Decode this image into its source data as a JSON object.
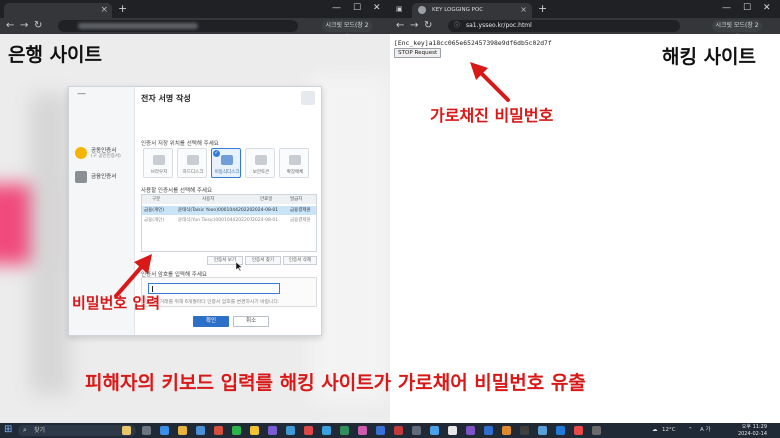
{
  "left_browser": {
    "tab_close": "×",
    "new_tab": "+",
    "window_controls": [
      "—",
      "☐",
      "✕"
    ],
    "nav": [
      "←",
      "→",
      "↻"
    ],
    "profile_label": "시크릿 모드(창 2개)"
  },
  "right_browser": {
    "tab_title": "KEY LOGGING POC",
    "tab_close": "×",
    "new_tab": "+",
    "window_controls": [
      "—",
      "☐",
      "✕"
    ],
    "nav": [
      "←",
      "→",
      "↻"
    ],
    "url": "sa1.ysseo.kr/poc.html",
    "profile_label": "시크릿 모드(창 2개)",
    "enc_text": "[Enc_key]a18cc065e652457398e9df6db5c02d7f",
    "stop_button": "STOP Request"
  },
  "annotations": {
    "bank_site": "은행 사이트",
    "hacking_site": "해킹 사이트",
    "intercepted_password": "가로채진 비밀번호",
    "password_input": "비밀번호 입력",
    "caption": "피해자의 키보드 입력를 해킹 사이트가 가로채어 비밀번호 유출",
    "arrow_color": "#d91818"
  },
  "dialog": {
    "minimize": "—",
    "title": "전자 서명 작성",
    "sidebar": [
      {
        "label": "공동인증서",
        "sub": "(구 공인인증서)"
      },
      {
        "label": "금융인증서",
        "sub": ""
      }
    ],
    "storage_prompt": "인증서 저장 위치를 선택해 주세요",
    "storage_locations": [
      {
        "label": "브라우저",
        "selected": false
      },
      {
        "label": "하드디스크",
        "selected": false
      },
      {
        "label": "이동식디스크",
        "selected": true
      },
      {
        "label": "보안토큰",
        "selected": false
      },
      {
        "label": "확장매체",
        "selected": false
      }
    ],
    "cert_prompt": "사용할 인증서를 선택해 주세요",
    "table_headers": [
      "구분",
      "사용자",
      "만료일",
      "발급자"
    ],
    "table_rows": [
      [
        "금융(개인)",
        "윤태식(Taisic Yoon)0001044202207...",
        "2024-08-01",
        "금융결제원"
      ],
      [
        "금융(개인)",
        "윤태식(Yun Taisic)0001044202207...",
        "2024-08-01",
        "금융결제원"
      ]
    ],
    "cert_buttons": [
      "인증서 보기",
      "인증서 찾기",
      "인증서 삭제"
    ],
    "pw_prompt": "인증서 암호를 입력해 주세요",
    "pw_hint": "안전한 거래를 위해 6개월마다 인증서 암호를 변경하시기 바랍니다.",
    "ok": "확인",
    "cancel": "취소"
  },
  "taskbar": {
    "search_placeholder": "찾기",
    "weather": "12°C",
    "ime": "A 가",
    "time": "오후 11:29",
    "date": "2024-02-14"
  }
}
